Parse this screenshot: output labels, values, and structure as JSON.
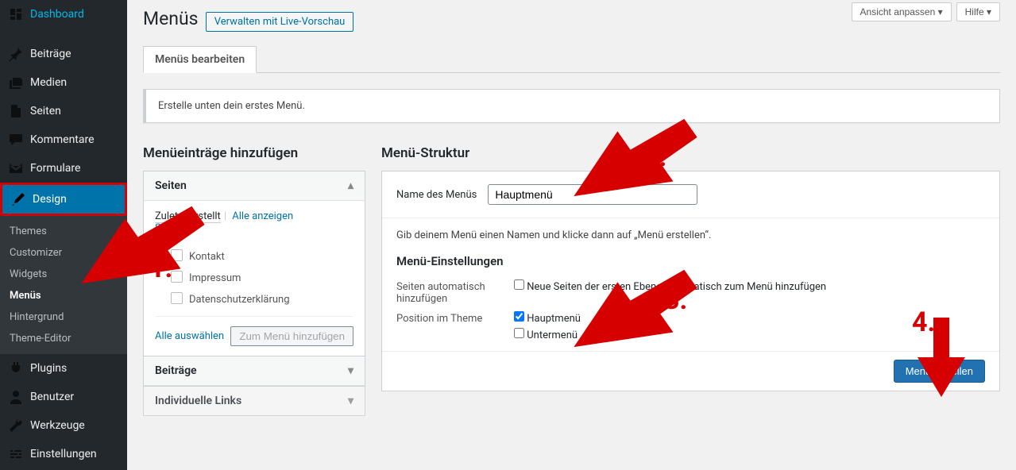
{
  "sidebar": {
    "items": [
      {
        "label": "Dashboard",
        "icon": "dashboard-icon"
      },
      {
        "label": "Beiträge",
        "icon": "pin-icon"
      },
      {
        "label": "Medien",
        "icon": "media-icon"
      },
      {
        "label": "Seiten",
        "icon": "page-icon"
      },
      {
        "label": "Kommentare",
        "icon": "comment-icon"
      },
      {
        "label": "Formulare",
        "icon": "form-icon"
      },
      {
        "label": "Design",
        "icon": "brush-icon",
        "current": true,
        "highlight": true
      },
      {
        "label": "Plugins",
        "icon": "plugin-icon"
      },
      {
        "label": "Benutzer",
        "icon": "user-icon"
      },
      {
        "label": "Werkzeuge",
        "icon": "tool-icon"
      },
      {
        "label": "Einstellungen",
        "icon": "settings-icon"
      }
    ],
    "design_submenu": [
      "Themes",
      "Customizer",
      "Widgets",
      "Menüs",
      "Hintergrund",
      "Theme-Editor"
    ],
    "design_submenu_current": "Menüs"
  },
  "topbar": {
    "screen_options": "Ansicht anpassen",
    "help": "Hilfe"
  },
  "page": {
    "title": "Menüs",
    "live_preview_btn": "Verwalten mit Live-Vorschau",
    "tab": "Menüs bearbeiten",
    "notice": "Erstelle unten dein erstes Menü."
  },
  "left": {
    "heading": "Menüeinträge hinzufügen",
    "acc1": {
      "title": "Seiten",
      "tabs": {
        "recent": "Zuletzt erstellt",
        "all": "Alle anzeigen",
        "search": "Suchen"
      },
      "pages": [
        "Kontakt",
        "Impressum",
        "Datenschutzerklärung"
      ],
      "select_all": "Alle auswählen",
      "add_btn": "Zum Menü hinzufügen"
    },
    "acc2": {
      "title": "Beiträge"
    },
    "acc3": {
      "title": "Individuelle Links"
    }
  },
  "right": {
    "heading": "Menü-Struktur",
    "name_label": "Name des Menüs",
    "name_value": "Hauptmenü",
    "hint": "Gib deinem Menü einen Namen und klicke dann auf „Menü erstellen“.",
    "settings_heading": "Menü-Einstellungen",
    "auto_label": "Seiten automatisch hinzufügen",
    "auto_opt": "Neue Seiten der ersten Ebene automatisch zum Menü hinzufügen",
    "pos_label": "Position im Theme",
    "pos_opt1": "Hauptmenü",
    "pos_opt2": "Untermenü",
    "create_btn": "Menü erstellen"
  },
  "annotations": {
    "n1": "1.",
    "n2": "2.",
    "n3": "3.",
    "n4": "4."
  }
}
